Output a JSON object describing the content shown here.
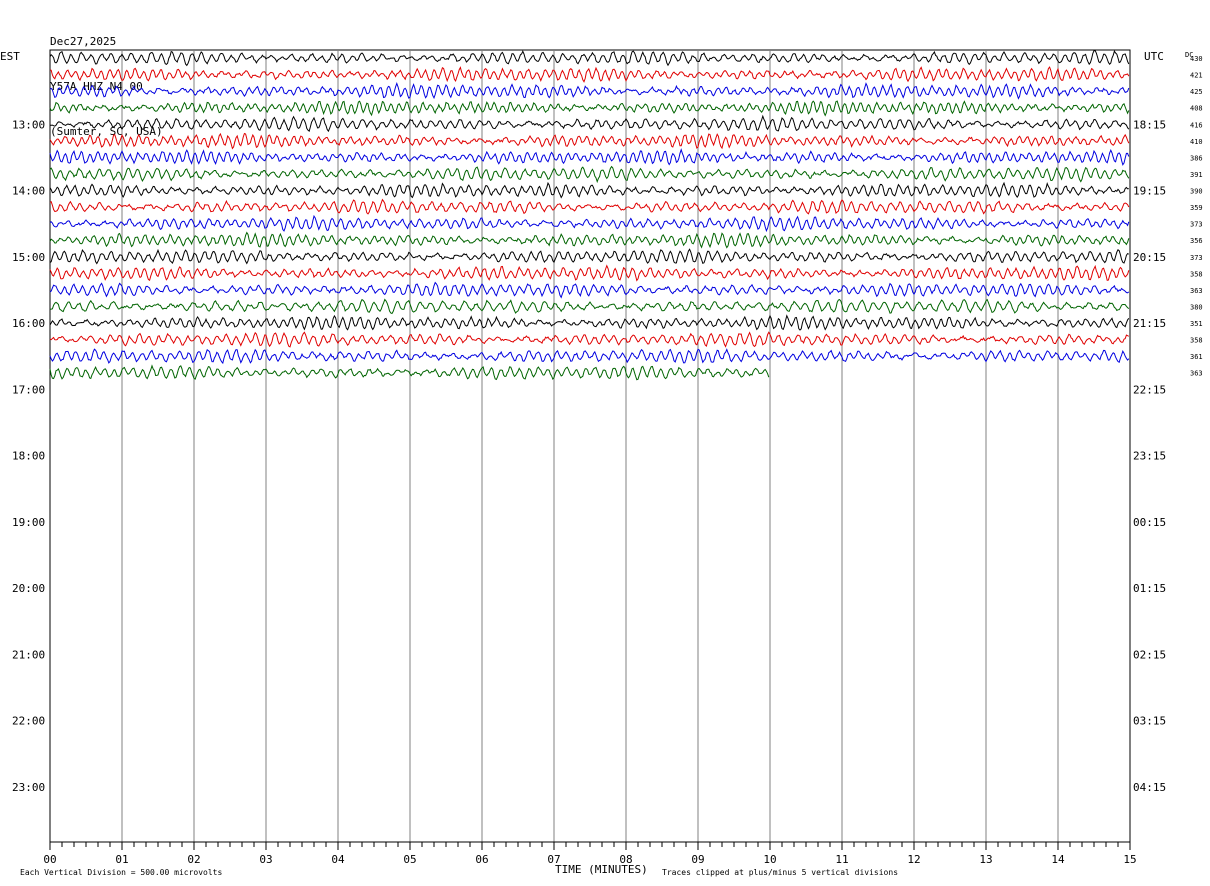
{
  "header": {
    "date": "Dec27,2025",
    "station": "Y57A HHZ N4 00",
    "location": "(Sumter, SC, USA)"
  },
  "labels": {
    "left_zone": "EST",
    "right_zone": "UTC",
    "dc_header": "DC",
    "xlabel": "TIME (MINUTES)",
    "scale_note": "Each Vertical Division = 500.00 microvolts",
    "clip_note": "Traces clipped at plus/minus 5 vertical divisions"
  },
  "chart_data": {
    "type": "line",
    "title": "Y57A HHZ N4 00",
    "xlabel": "TIME (MINUTES)",
    "xlim": [
      0,
      15
    ],
    "x_ticks": [
      "00",
      "01",
      "02",
      "03",
      "04",
      "05",
      "06",
      "07",
      "08",
      "09",
      "10",
      "11",
      "12",
      "13",
      "14",
      "15"
    ],
    "left_hour_labels": [
      "13:00",
      "14:00",
      "15:00",
      "16:00",
      "17:00",
      "18:00",
      "19:00",
      "20:00",
      "21:00",
      "22:00",
      "23:00"
    ],
    "right_hour_labels": [
      "18:15",
      "19:15",
      "20:15",
      "21:15",
      "22:15",
      "23:15",
      "00:15",
      "01:15",
      "02:15",
      "03:15",
      "04:15"
    ],
    "trace_colors": [
      "#000000",
      "#e00000",
      "#0000e0",
      "#006400"
    ],
    "traces_per_hour": 4,
    "minutes_per_trace": 15,
    "first_trace_start": "12:00",
    "dc_offsets": [
      430,
      421,
      425,
      408,
      416,
      410,
      386,
      391,
      390,
      359,
      373,
      356,
      373,
      358,
      363,
      380,
      351,
      358,
      361,
      363
    ],
    "last_trace_end_minute": 10,
    "grid": true
  }
}
